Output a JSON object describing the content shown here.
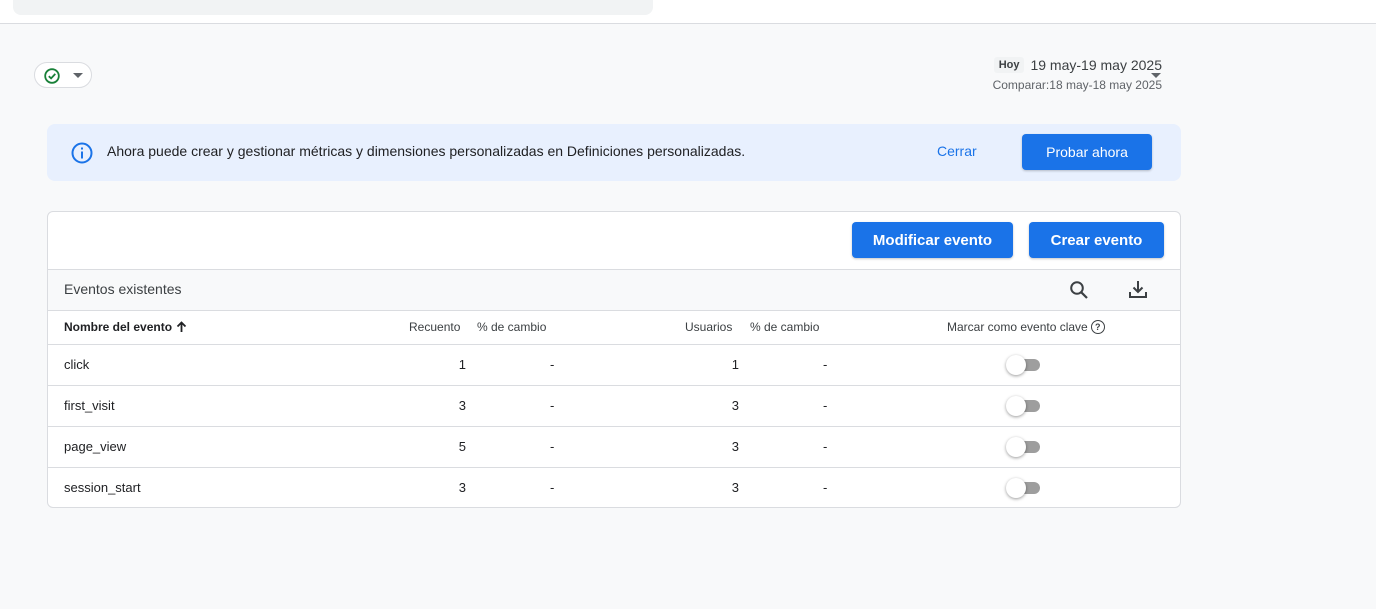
{
  "header": {
    "status_icon": "check-circle-icon",
    "date": {
      "today_label": "Hoy",
      "range": "19 may-19 may 2025",
      "compare_label": "Comparar:",
      "compare_range": "18 may-18 may 2025"
    }
  },
  "banner": {
    "icon": "info-icon",
    "message": "Ahora puede crear y gestionar métricas y dimensiones personalizadas en Definiciones personalizadas.",
    "close_label": "Cerrar",
    "try_label": "Probar ahora"
  },
  "events": {
    "modify_label": "Modificar evento",
    "create_label": "Crear evento",
    "section_title": "Eventos existentes",
    "columns": {
      "name": "Nombre del evento",
      "count": "Recuento",
      "change1": "% de cambio",
      "users": "Usuarios",
      "change2": "% de cambio",
      "key_event": "Marcar como evento clave"
    },
    "rows": [
      {
        "name": "click",
        "count": "1",
        "change1": "-",
        "users": "1",
        "change2": "-",
        "key_event": false
      },
      {
        "name": "first_visit",
        "count": "3",
        "change1": "-",
        "users": "3",
        "change2": "-",
        "key_event": false
      },
      {
        "name": "page_view",
        "count": "5",
        "change1": "-",
        "users": "3",
        "change2": "-",
        "key_event": false
      },
      {
        "name": "session_start",
        "count": "3",
        "change1": "-",
        "users": "3",
        "change2": "-",
        "key_event": false
      }
    ]
  },
  "colors": {
    "accent": "#1a73e8",
    "banner_bg": "#e8f0fe",
    "status_ok": "#188038"
  }
}
